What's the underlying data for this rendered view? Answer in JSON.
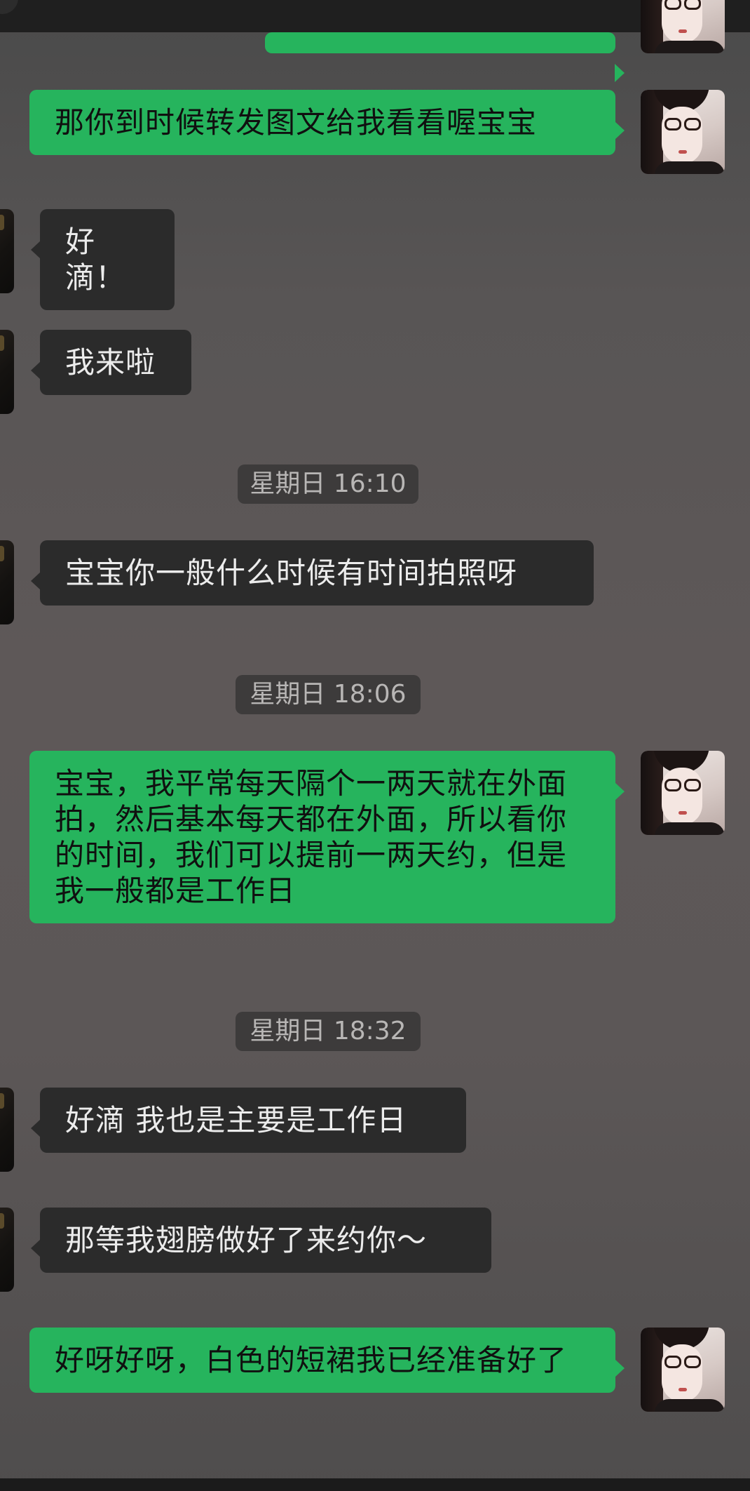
{
  "chat": {
    "timestamps": {
      "t1": "星期日 16:10",
      "t2": "星期日 18:06",
      "t3": "星期日 18:32"
    },
    "messages": [
      {
        "sender": "me",
        "text": "那你到时候转发图文给我看看喔宝宝"
      },
      {
        "sender": "them",
        "text": "好滴！"
      },
      {
        "sender": "them",
        "text": "我来啦"
      },
      {
        "sender": "them",
        "text": "宝宝你一般什么时候有时间拍照呀"
      },
      {
        "sender": "me",
        "text": "宝宝，我平常每天隔个一两天就在外面拍，然后基本每天都在外面，所以看你的时间，我们可以提前一两天约，但是我一般都是工作日"
      },
      {
        "sender": "them",
        "text": "好滴 我也是主要是工作日"
      },
      {
        "sender": "them",
        "text": "那等我翅膀做好了来约你～"
      },
      {
        "sender": "me",
        "text": "好呀好呀，白色的短裙我已经准备好了"
      }
    ]
  },
  "colors": {
    "outgoing_bubble": "#26b45d",
    "incoming_bubble": "#2b2b2b",
    "timestamp_pill": "#3d3b3b"
  },
  "icons": {
    "my_avatar": "profile-photo-girl-glasses",
    "contact_avatar": "profile-photo-dark"
  }
}
